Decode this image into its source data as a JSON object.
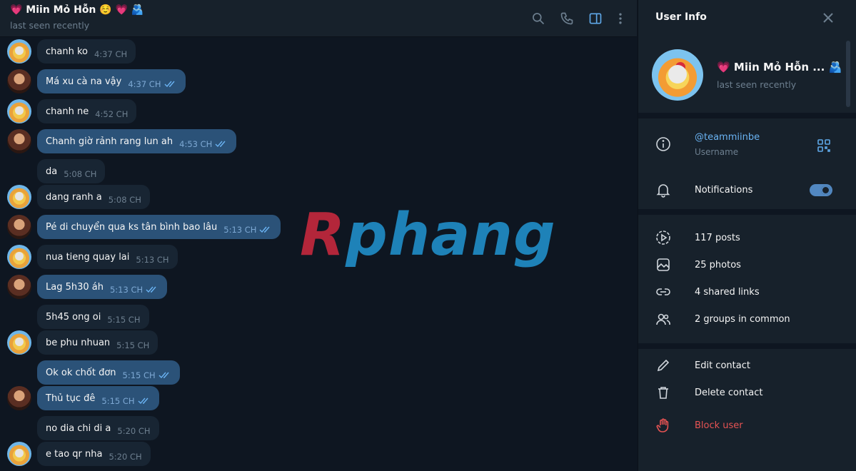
{
  "header": {
    "title": "💗 Miin Mỏ Hỗn ☺️ 💗 🫂",
    "status": "last seen recently"
  },
  "messages": [
    {
      "from": "them",
      "text": "chanh ko",
      "time": "4:37 CH",
      "avatar": true
    },
    {
      "from": "me",
      "text": "Má xu cà na vậy",
      "time": "4:37 CH",
      "avatar": true
    },
    {
      "from": "them",
      "text": "chanh ne",
      "time": "4:52 CH",
      "avatar": true
    },
    {
      "from": "me",
      "text": "Chanh giờ rảnh rang lun ah",
      "time": "4:53 CH",
      "avatar": true
    },
    {
      "from": "them",
      "text": "da",
      "time": "5:08 CH",
      "avatar": false
    },
    {
      "from": "them",
      "text": "dang ranh a",
      "time": "5:08 CH",
      "avatar": true
    },
    {
      "from": "me",
      "text": "Pé di chuyển qua ks tân bình bao lâu",
      "time": "5:13 CH",
      "avatar": true
    },
    {
      "from": "them",
      "text": "nua tieng quay lai",
      "time": "5:13 CH",
      "avatar": true
    },
    {
      "from": "me",
      "text": "Lag 5h30 áh",
      "time": "5:13 CH",
      "avatar": true
    },
    {
      "from": "them",
      "text": "5h45 ong oi",
      "time": "5:15 CH",
      "avatar": false
    },
    {
      "from": "them",
      "text": "be phu nhuan",
      "time": "5:15 CH",
      "avatar": true
    },
    {
      "from": "me",
      "text": "Ok ok chốt đơn",
      "time": "5:15 CH",
      "avatar": false
    },
    {
      "from": "me",
      "text": "Thủ tục đê",
      "time": "5:15 CH",
      "avatar": true
    },
    {
      "from": "them",
      "text": "no dia chi di a",
      "time": "5:20 CH",
      "avatar": false
    },
    {
      "from": "them",
      "text": "e tao qr nha",
      "time": "5:20 CH",
      "avatar": true
    }
  ],
  "watermark": {
    "first": "R",
    "rest": "phang"
  },
  "panel": {
    "title": "User Info",
    "name": "💗 Miin Mỏ Hỗn ... 🫂",
    "seen": "last seen recently",
    "username": "@teammiinbe",
    "username_label": "Username",
    "notifications": "Notifications",
    "notifications_on": true,
    "posts": "117 posts",
    "photos": "25 photos",
    "links": "4 shared links",
    "groups": "2 groups in common",
    "edit": "Edit contact",
    "delete": "Delete contact",
    "block": "Block user"
  },
  "colors": {
    "bg": "#0e1621",
    "panel": "#17212b",
    "bubble_in": "#182533",
    "bubble_out": "#2b5278",
    "accent": "#6ab3f3",
    "danger": "#e65353"
  }
}
